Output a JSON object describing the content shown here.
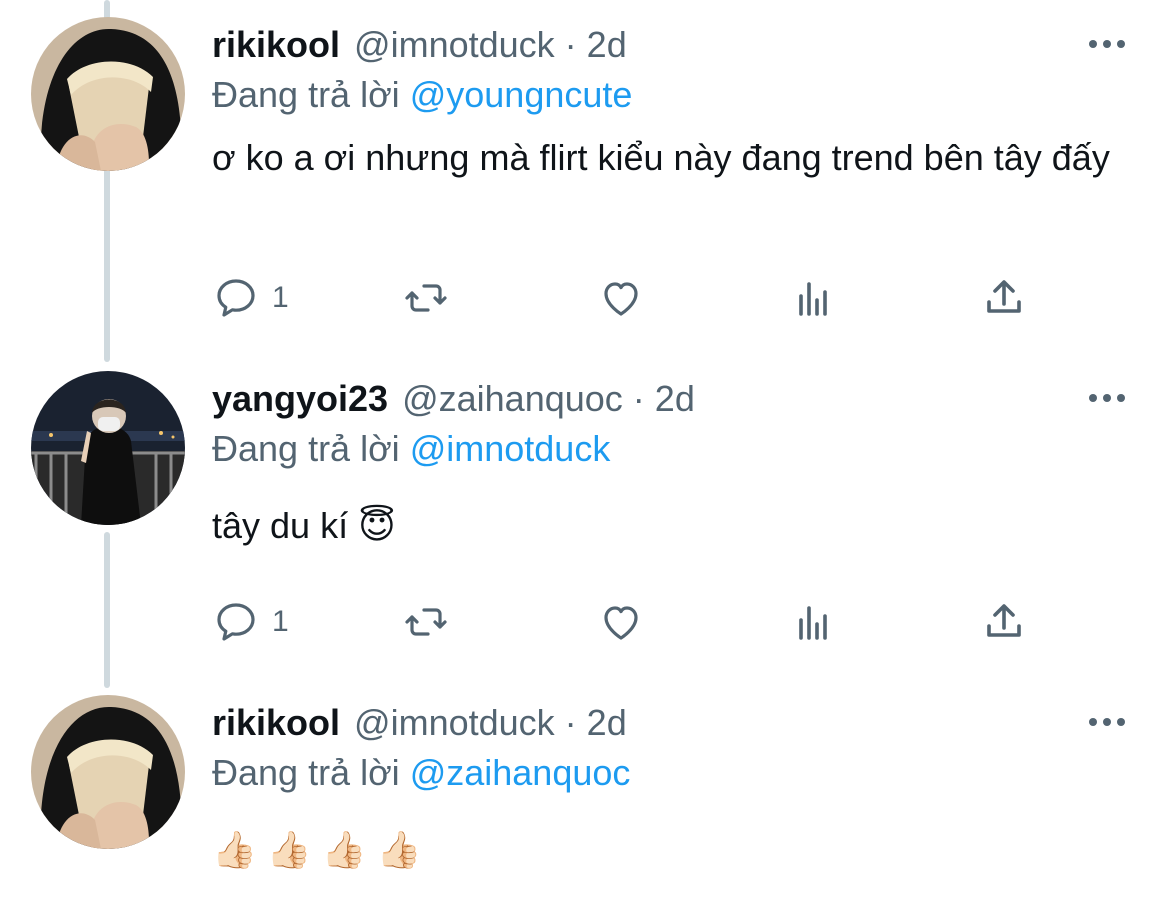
{
  "tweets": [
    {
      "name": "rikikool",
      "handle": "@imnotduck",
      "separator": "·",
      "time": "2d",
      "reply_prefix": "Đang trả lời",
      "reply_to": "@youngncute",
      "text": "ơ ko a ơi nhưng mà flirt kiểu này đang trend bên tây đấy",
      "reply_count": "1",
      "avatar_icon": "avatar-photo-person-hood"
    },
    {
      "name": "yangyoi23",
      "handle": "@zaihanquoc",
      "separator": "·",
      "time": "2d",
      "reply_prefix": "Đang trả lời",
      "reply_to": "@imnotduck",
      "text": "tây du kí",
      "text_emoji": "😇",
      "reply_count": "1",
      "avatar_icon": "avatar-photo-person-night-city"
    },
    {
      "name": "rikikool",
      "handle": "@imnotduck",
      "separator": "·",
      "time": "2d",
      "reply_prefix": "Đang trả lời",
      "reply_to": "@zaihanquoc",
      "text_emojis": [
        "👍🏻",
        "👍🏻",
        "👍🏻",
        "👍🏻"
      ],
      "avatar_icon": "avatar-photo-person-hood"
    }
  ],
  "icons": {
    "reply": "reply-icon",
    "retweet": "retweet-icon",
    "like": "like-heart-icon",
    "views": "views-chart-icon",
    "share": "share-icon",
    "more": "more-dots-icon"
  },
  "colors": {
    "text": "#0f1419",
    "secondary": "#536471",
    "link": "#1d9bf0",
    "thread_line": "#cfd9de"
  }
}
